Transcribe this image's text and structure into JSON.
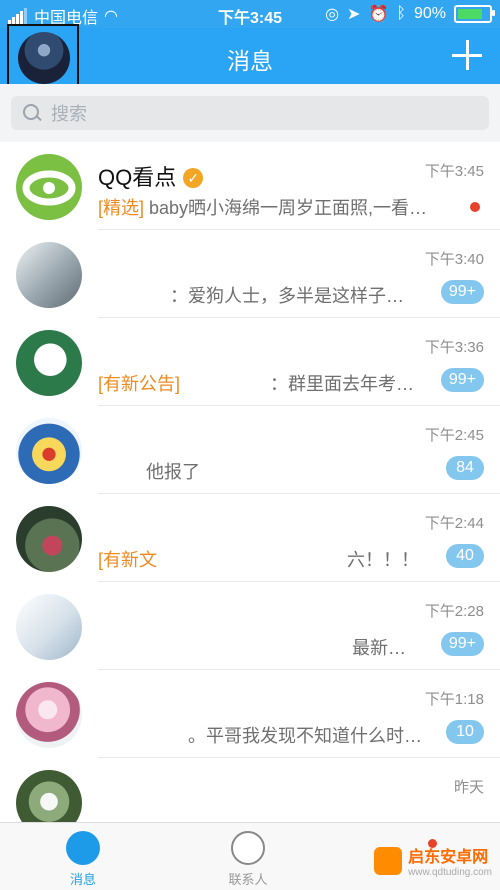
{
  "status": {
    "carrier": "中国电信",
    "time": "下午3:45",
    "battery": "90%"
  },
  "header": {
    "title": "消息"
  },
  "search": {
    "placeholder": "搜索"
  },
  "chats": [
    {
      "name": "QQ看点",
      "message_prefix": "[精选]",
      "message": " baby晒小海绵一周岁正面照,一看…",
      "time": "下午3:45",
      "badge": "",
      "colors": [
        "#7bc043",
        "#ffffff"
      ]
    },
    {
      "name": "",
      "message_prefix": "",
      "message": "：爱狗人士，多半是这样子…",
      "time": "下午3:40",
      "badge": "99+",
      "colors": [
        "#d9e2e6",
        "#90a4ae"
      ]
    },
    {
      "name": "",
      "message_prefix": "[有新公告]",
      "message": "：群里面去年考…",
      "time": "下午3:36",
      "badge": "99+",
      "colors": [
        "#2c7a49",
        "#d7efe0"
      ]
    },
    {
      "name": "",
      "message_prefix": "",
      "message": "他报了",
      "time": "下午2:45",
      "badge": "84",
      "colors": [
        "#3a6ab7",
        "#f5d86f"
      ]
    },
    {
      "name": "",
      "message_prefix": "[有新文",
      "message": "六！！！",
      "time": "下午2:44",
      "badge": "40",
      "colors": [
        "#344e3a",
        "#c2455b"
      ]
    },
    {
      "name": "",
      "message_prefix": "",
      "message": "最新…",
      "time": "下午2:28",
      "badge": "99+",
      "colors": [
        "#f0f4f7",
        "#a8bccd"
      ]
    },
    {
      "name": "",
      "message_prefix": "",
      "message": "。平哥我发现不知道什么时…",
      "time": "下午1:18",
      "badge": "10",
      "colors": [
        "#f3c5d4",
        "#bf6d8d"
      ]
    },
    {
      "name": "",
      "message_prefix": "",
      "message": "",
      "time": "昨天",
      "badge": "",
      "colors": [
        "#4d6f43",
        "#dce8d1"
      ]
    }
  ],
  "tabs": {
    "messages": "消息",
    "contacts": "联系人"
  },
  "watermark": {
    "name": "启东安卓网",
    "url": "www.qdtuding.com"
  }
}
